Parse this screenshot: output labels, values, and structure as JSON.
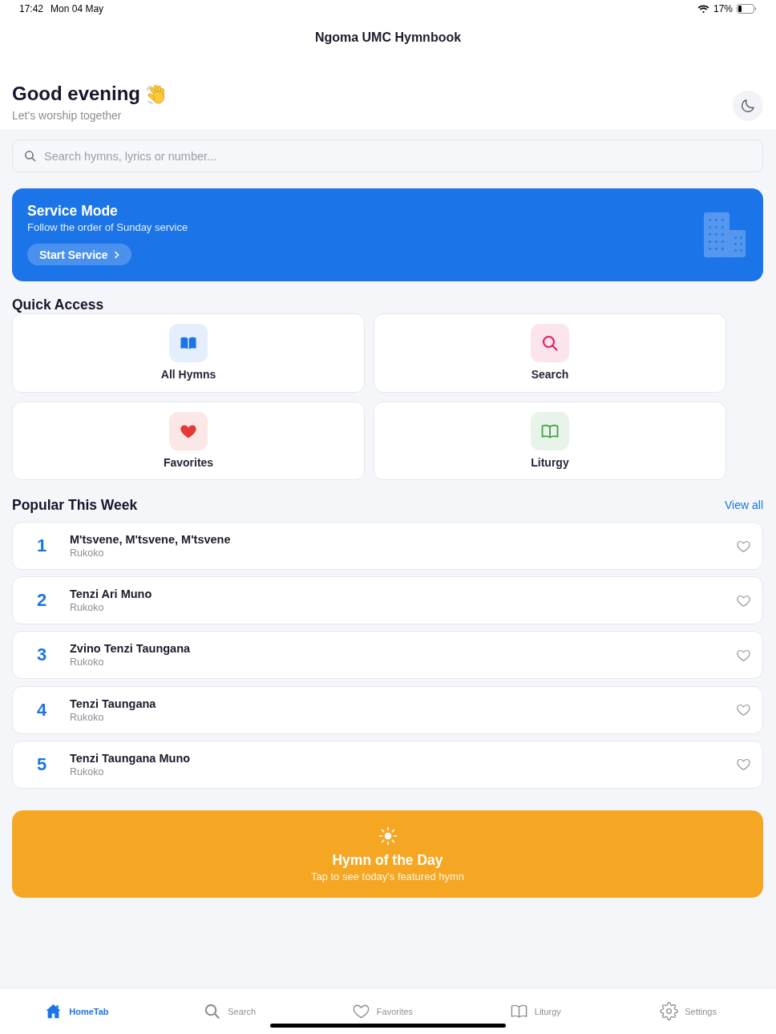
{
  "status_bar": {
    "time": "17:42",
    "date": "Mon 04 May",
    "battery": "17%"
  },
  "header": {
    "title": "Ngoma UMC Hymnbook"
  },
  "greeting": {
    "title": "Good evening",
    "subtitle": "Let's worship together"
  },
  "search": {
    "placeholder": "Search hymns, lyrics or number..."
  },
  "service_mode": {
    "title": "Service Mode",
    "subtitle": "Follow the order of Sunday service",
    "button": "Start Service"
  },
  "quick_access": {
    "title": "Quick Access",
    "items": [
      {
        "label": "All Hymns",
        "kind": "book",
        "color": "#1a73e8"
      },
      {
        "label": "Search",
        "kind": "search",
        "color": "#e91e63"
      },
      {
        "label": "Favorites",
        "kind": "heart",
        "color": "#e53935"
      },
      {
        "label": "Liturgy",
        "kind": "book-outline",
        "color": "#43a047"
      }
    ]
  },
  "popular": {
    "title": "Popular This Week",
    "link": "View all",
    "hymns": [
      {
        "number": "1",
        "title": "M'tsvene, M'tsvene, M'tsvene",
        "subtitle": "Rukoko",
        "favorite": false
      },
      {
        "number": "2",
        "title": "Tenzi Ari Muno",
        "subtitle": "Rukoko",
        "favorite": false
      },
      {
        "number": "3",
        "title": "Zvino Tenzi Taungana",
        "subtitle": "Rukoko",
        "favorite": false
      },
      {
        "number": "4",
        "title": "Tenzi Taungana",
        "subtitle": "Rukoko",
        "favorite": false
      },
      {
        "number": "5",
        "title": "Tenzi Taungana Muno",
        "subtitle": "Rukoko",
        "favorite": false
      }
    ]
  },
  "hymn_of_the_day": {
    "title": "Hymn of the Day",
    "subtitle": "Tap to see today's featured hymn"
  },
  "tab_bar": {
    "tabs": [
      {
        "label": "HomeTab",
        "kind": "home",
        "selected": true
      },
      {
        "label": "Search",
        "kind": "search",
        "selected": false
      },
      {
        "label": "Favorites",
        "kind": "heart",
        "selected": false
      },
      {
        "label": "Liturgy",
        "kind": "book",
        "selected": false
      },
      {
        "label": "Settings",
        "kind": "gear",
        "selected": false
      }
    ]
  }
}
